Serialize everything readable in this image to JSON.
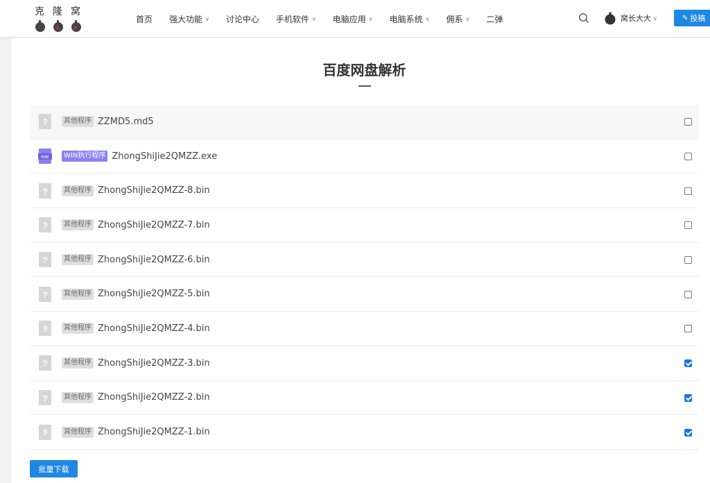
{
  "header": {
    "logo_text": "克隆窝",
    "nav": [
      {
        "label": "首页",
        "has_dropdown": false
      },
      {
        "label": "强大功能",
        "has_dropdown": true
      },
      {
        "label": "讨论中心",
        "has_dropdown": false
      },
      {
        "label": "手机软件",
        "has_dropdown": true
      },
      {
        "label": "电脑应用",
        "has_dropdown": true
      },
      {
        "label": "电脑系统",
        "has_dropdown": true
      },
      {
        "label": "佣系",
        "has_dropdown": true
      },
      {
        "label": "二弹",
        "has_dropdown": false
      }
    ],
    "user_name": "窝长大大",
    "contribute_label": "投稿",
    "icons": {
      "search": "search-icon",
      "edit": "edit-icon",
      "avatar": "avatar-icon",
      "chevron": "chevron-down-icon"
    }
  },
  "page": {
    "title": "百度网盘解析",
    "download_label": "批量下载"
  },
  "files": [
    {
      "tag": "其他程序",
      "type": "other",
      "name": "ZZMD5.md5",
      "checked": false
    },
    {
      "tag": "WIN执行程序",
      "type": "win",
      "name": "ZhongShiJie2QMZZ.exe",
      "checked": false
    },
    {
      "tag": "其他程序",
      "type": "other",
      "name": "ZhongShiJie2QMZZ-8.bin",
      "checked": false
    },
    {
      "tag": "其他程序",
      "type": "other",
      "name": "ZhongShiJie2QMZZ-7.bin",
      "checked": false
    },
    {
      "tag": "其他程序",
      "type": "other",
      "name": "ZhongShiJie2QMZZ-6.bin",
      "checked": false
    },
    {
      "tag": "其他程序",
      "type": "other",
      "name": "ZhongShiJie2QMZZ-5.bin",
      "checked": false
    },
    {
      "tag": "其他程序",
      "type": "other",
      "name": "ZhongShiJie2QMZZ-4.bin",
      "checked": false
    },
    {
      "tag": "其他程序",
      "type": "other",
      "name": "ZhongShiJie2QMZZ-3.bin",
      "checked": true
    },
    {
      "tag": "其他程序",
      "type": "other",
      "name": "ZhongShiJie2QMZZ-2.bin",
      "checked": true
    },
    {
      "tag": "其他程序",
      "type": "other",
      "name": "ZhongShiJie2QMZZ-1.bin",
      "checked": true
    }
  ],
  "colors": {
    "accent": "#1e88e5",
    "win_tag": "#8c80f2",
    "other_tag": "#dedede",
    "page_bg": "#f1f1f1"
  }
}
